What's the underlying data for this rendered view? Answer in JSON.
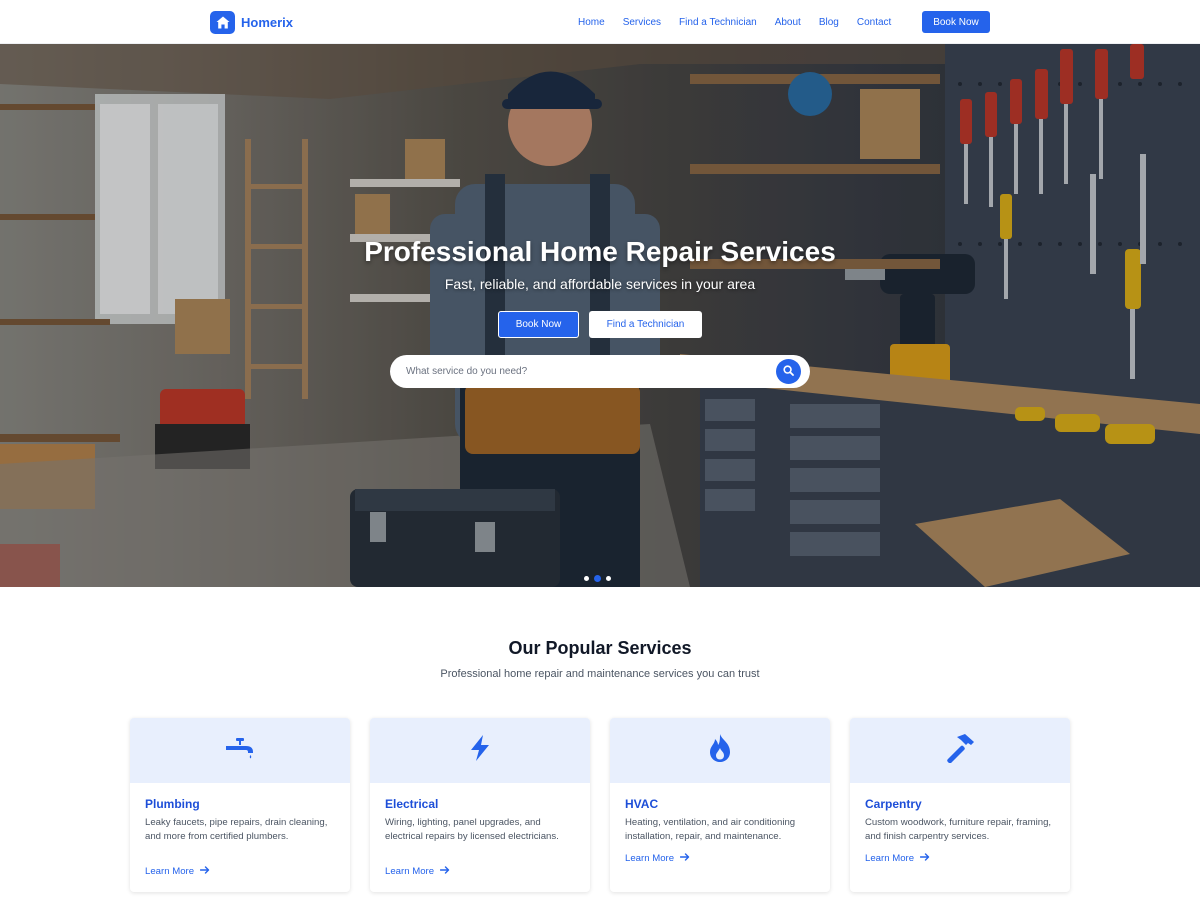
{
  "nav": {
    "brand": "Homerix",
    "links": [
      "Home",
      "Services",
      "Find a Technician",
      "About",
      "Blog",
      "Contact"
    ],
    "cta": "Book Now"
  },
  "hero": {
    "title": "Professional Home Repair Services",
    "subtitle": "Fast, reliable, and affordable services in your area",
    "primary_button": "Book Now",
    "secondary_button": "Find a Technician",
    "search_placeholder": "What service do you need?",
    "slides": 3,
    "active_slide": 2
  },
  "services": {
    "title": "Our Popular Services",
    "subtitle": "Professional home repair and maintenance services you can trust",
    "cards": [
      {
        "icon": "faucet-icon",
        "title": "Plumbing",
        "description": "Leaky faucets, pipe repairs, drain cleaning, and more from certified plumbers.",
        "link": "Learn More"
      },
      {
        "icon": "bolt-icon",
        "title": "Electrical",
        "description": "Wiring, lighting, panel upgrades, and electrical repairs by licensed electricians.",
        "link": "Learn More"
      },
      {
        "icon": "flame-icon",
        "title": "HVAC",
        "description": "Heating, ventilation, and air conditioning installation, repair, and maintenance.",
        "link": "Learn More"
      },
      {
        "icon": "hammer-icon",
        "title": "Carpentry",
        "description": "Custom woodwork, furniture repair, framing, and finish carpentry services.",
        "link": "Learn More"
      }
    ]
  },
  "colors": {
    "accent": "#2563eb",
    "card_top": "#e8effd"
  }
}
